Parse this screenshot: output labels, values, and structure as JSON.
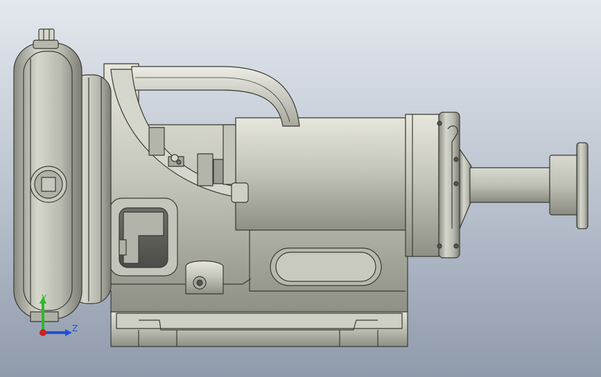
{
  "viewport": {
    "background_top": "#e4e8ee",
    "background_bottom": "#8f9aab",
    "model_color": "#c7c8bd",
    "edge_color": "#3a3a34"
  },
  "triad": {
    "y_label": "Y",
    "z_label": "Z",
    "y_color": "#2db82d",
    "z_color": "#1f4fd8",
    "x_color": "#d02020"
  }
}
